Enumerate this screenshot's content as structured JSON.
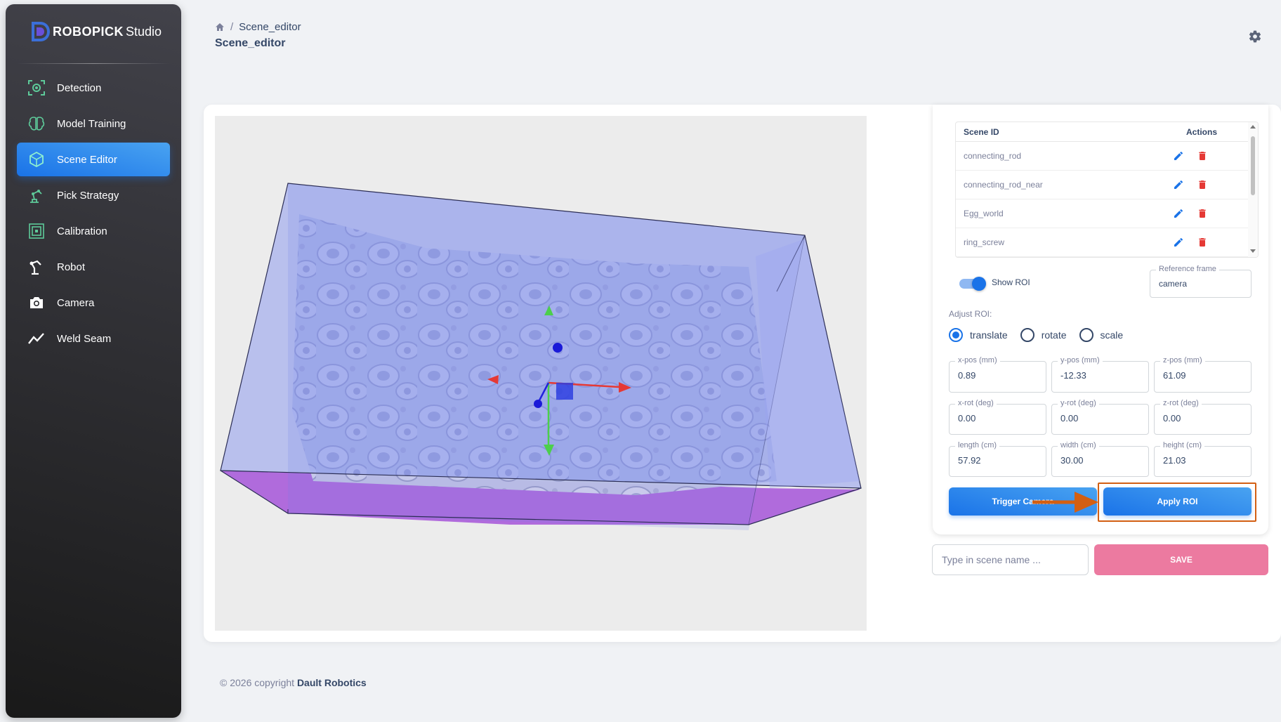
{
  "brand": {
    "name_bold": "ROBOPICK",
    "name_light": "Studio"
  },
  "sidebar": {
    "items": [
      {
        "label": "Detection",
        "icon": "detection-icon",
        "active": false
      },
      {
        "label": "Model Training",
        "icon": "brain-icon",
        "active": false
      },
      {
        "label": "Scene Editor",
        "icon": "scene-editor-icon",
        "active": true
      },
      {
        "label": "Pick Strategy",
        "icon": "robot-arm-icon",
        "active": false
      },
      {
        "label": "Calibration",
        "icon": "calibration-icon",
        "active": false
      },
      {
        "label": "Robot",
        "icon": "robot-icon",
        "active": false
      },
      {
        "label": "Camera",
        "icon": "camera-icon",
        "active": false
      },
      {
        "label": "Weld Seam",
        "icon": "weld-seam-icon",
        "active": false
      }
    ]
  },
  "header": {
    "breadcrumb": "Scene_editor",
    "title": "Scene_editor"
  },
  "scene_table": {
    "col_id": "Scene ID",
    "col_actions": "Actions",
    "rows": [
      "connecting_rod",
      "connecting_rod_near",
      "Egg_world",
      "ring_screw"
    ]
  },
  "roi": {
    "show_roi_label": "Show ROI",
    "show_roi_on": true,
    "reference_frame_label": "Reference frame",
    "reference_frame_value": "camera",
    "adjust_label": "Adjust ROI:",
    "modes": [
      "translate",
      "rotate",
      "scale"
    ],
    "selected_mode": "translate",
    "fields": [
      {
        "label": "x-pos (mm)",
        "value": "0.89"
      },
      {
        "label": "y-pos (mm)",
        "value": "-12.33"
      },
      {
        "label": "z-pos (mm)",
        "value": "61.09"
      },
      {
        "label": "x-rot (deg)",
        "value": "0.00"
      },
      {
        "label": "y-rot (deg)",
        "value": "0.00"
      },
      {
        "label": "z-rot (deg)",
        "value": "0.00"
      },
      {
        "label": "length (cm)",
        "value": "57.92"
      },
      {
        "label": "width (cm)",
        "value": "30.00"
      },
      {
        "label": "height (cm)",
        "value": "21.03"
      }
    ],
    "trigger_camera": "Trigger Camera",
    "apply_roi": "Apply ROI"
  },
  "save": {
    "placeholder": "Type in scene name ...",
    "button": "SAVE"
  },
  "footer": {
    "prefix": "© 2026 copyright",
    "company": "Dault Robotics"
  },
  "colors": {
    "primary": "#1A73E8",
    "save": "#ec7aa0",
    "highlight": "#d35f13",
    "delete": "#e53935"
  }
}
